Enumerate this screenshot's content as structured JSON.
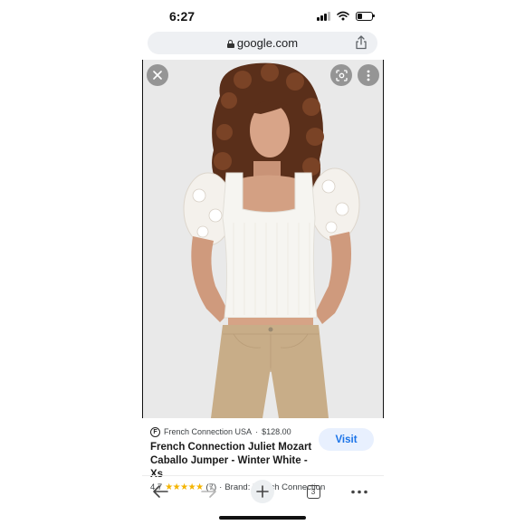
{
  "status_bar": {
    "time": "6:27",
    "battery_level": 0.35
  },
  "browser": {
    "url": "google.com",
    "icons": [
      "lock-icon",
      "share-icon"
    ]
  },
  "image_viewer": {
    "icons": [
      "close-icon",
      "google-lens-icon",
      "more-vert-icon"
    ]
  },
  "product": {
    "source": "French Connection USA",
    "separator": "·",
    "price": "$128.00",
    "source_logo_letter": "F",
    "title": "French Connection Juliet Mozart Caballo Jumper - Winter White - Xs",
    "rating": "4.7",
    "stars": "★★★★★",
    "review_count": "(7)",
    "brand": "Brand: French Connection",
    "visit_label": "Visit"
  },
  "toolbar": {
    "tab_count": "3",
    "icons": [
      "back-arrow-icon",
      "forward-arrow-icon",
      "plus-icon",
      "tab-switcher-icon",
      "more-horiz-icon"
    ]
  },
  "colors": {
    "accent": "#1a73e8",
    "visit_bg": "#e8f0fe",
    "star": "#f4b400",
    "url_bar_bg": "#eef0f3"
  }
}
